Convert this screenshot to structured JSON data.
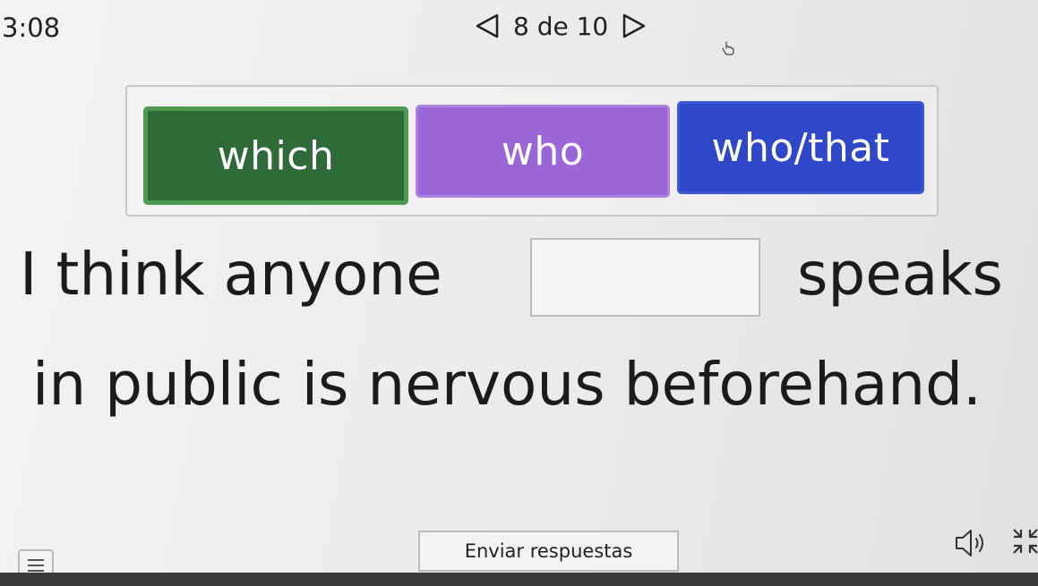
{
  "header": {
    "timer": "3:08",
    "pager_count": "8 de 10",
    "prev_icon": "triangle-left-icon",
    "next_icon": "triangle-right-icon"
  },
  "word_bank": {
    "options": [
      {
        "label": "which",
        "color": "#2f6b39"
      },
      {
        "label": "who",
        "color": "#9b67d8"
      },
      {
        "label": "who/that",
        "color": "#2f48c9"
      }
    ]
  },
  "sentence": {
    "before_blank": "I think anyone",
    "after_blank": "speaks",
    "line2": "in public is nervous beforehand."
  },
  "footer": {
    "submit_label": "Enviar respuestas",
    "menu_icon": "hamburger-menu-icon",
    "audio_icon": "speaker-icon",
    "expand_icon": "expand-icon"
  }
}
